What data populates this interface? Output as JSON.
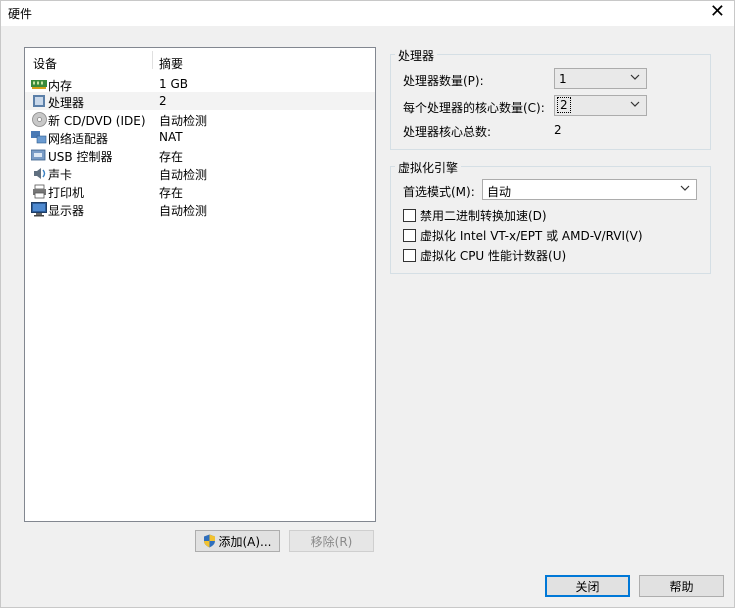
{
  "window": {
    "title": "硬件"
  },
  "device_list": {
    "col_device": "设备",
    "col_summary": "摘要",
    "rows": [
      {
        "name": "内存",
        "summary": "1 GB",
        "icon": "memory-icon"
      },
      {
        "name": "处理器",
        "summary": "2",
        "icon": "cpu-icon"
      },
      {
        "name": "新 CD/DVD (IDE)",
        "summary": "自动检测",
        "icon": "cd-dvd-icon"
      },
      {
        "name": "网络适配器",
        "summary": "NAT",
        "icon": "network-icon"
      },
      {
        "name": "USB 控制器",
        "summary": "存在",
        "icon": "usb-icon"
      },
      {
        "name": "声卡",
        "summary": "自动检测",
        "icon": "sound-icon"
      },
      {
        "name": "打印机",
        "summary": "存在",
        "icon": "printer-icon"
      },
      {
        "name": "显示器",
        "summary": "自动检测",
        "icon": "display-icon"
      }
    ],
    "add_button": "添加(A)...",
    "remove_button": "移除(R)"
  },
  "processor_group": {
    "title": "处理器",
    "count_label": "处理器数量(P):",
    "count_value": "1",
    "cores_label": "每个处理器的核心数量(C):",
    "cores_value": "2",
    "total_label": "处理器核心总数:",
    "total_value": "2"
  },
  "virtualization_group": {
    "title": "虚拟化引擎",
    "mode_label": "首选模式(M):",
    "mode_value": "自动",
    "opt1": "禁用二进制转换加速(D)",
    "opt2": "虚拟化 Intel VT-x/EPT 或 AMD-V/RVI(V)",
    "opt3": "虚拟化 CPU 性能计数器(U)"
  },
  "footer": {
    "close_button": "关闭",
    "help_button": "帮助"
  }
}
